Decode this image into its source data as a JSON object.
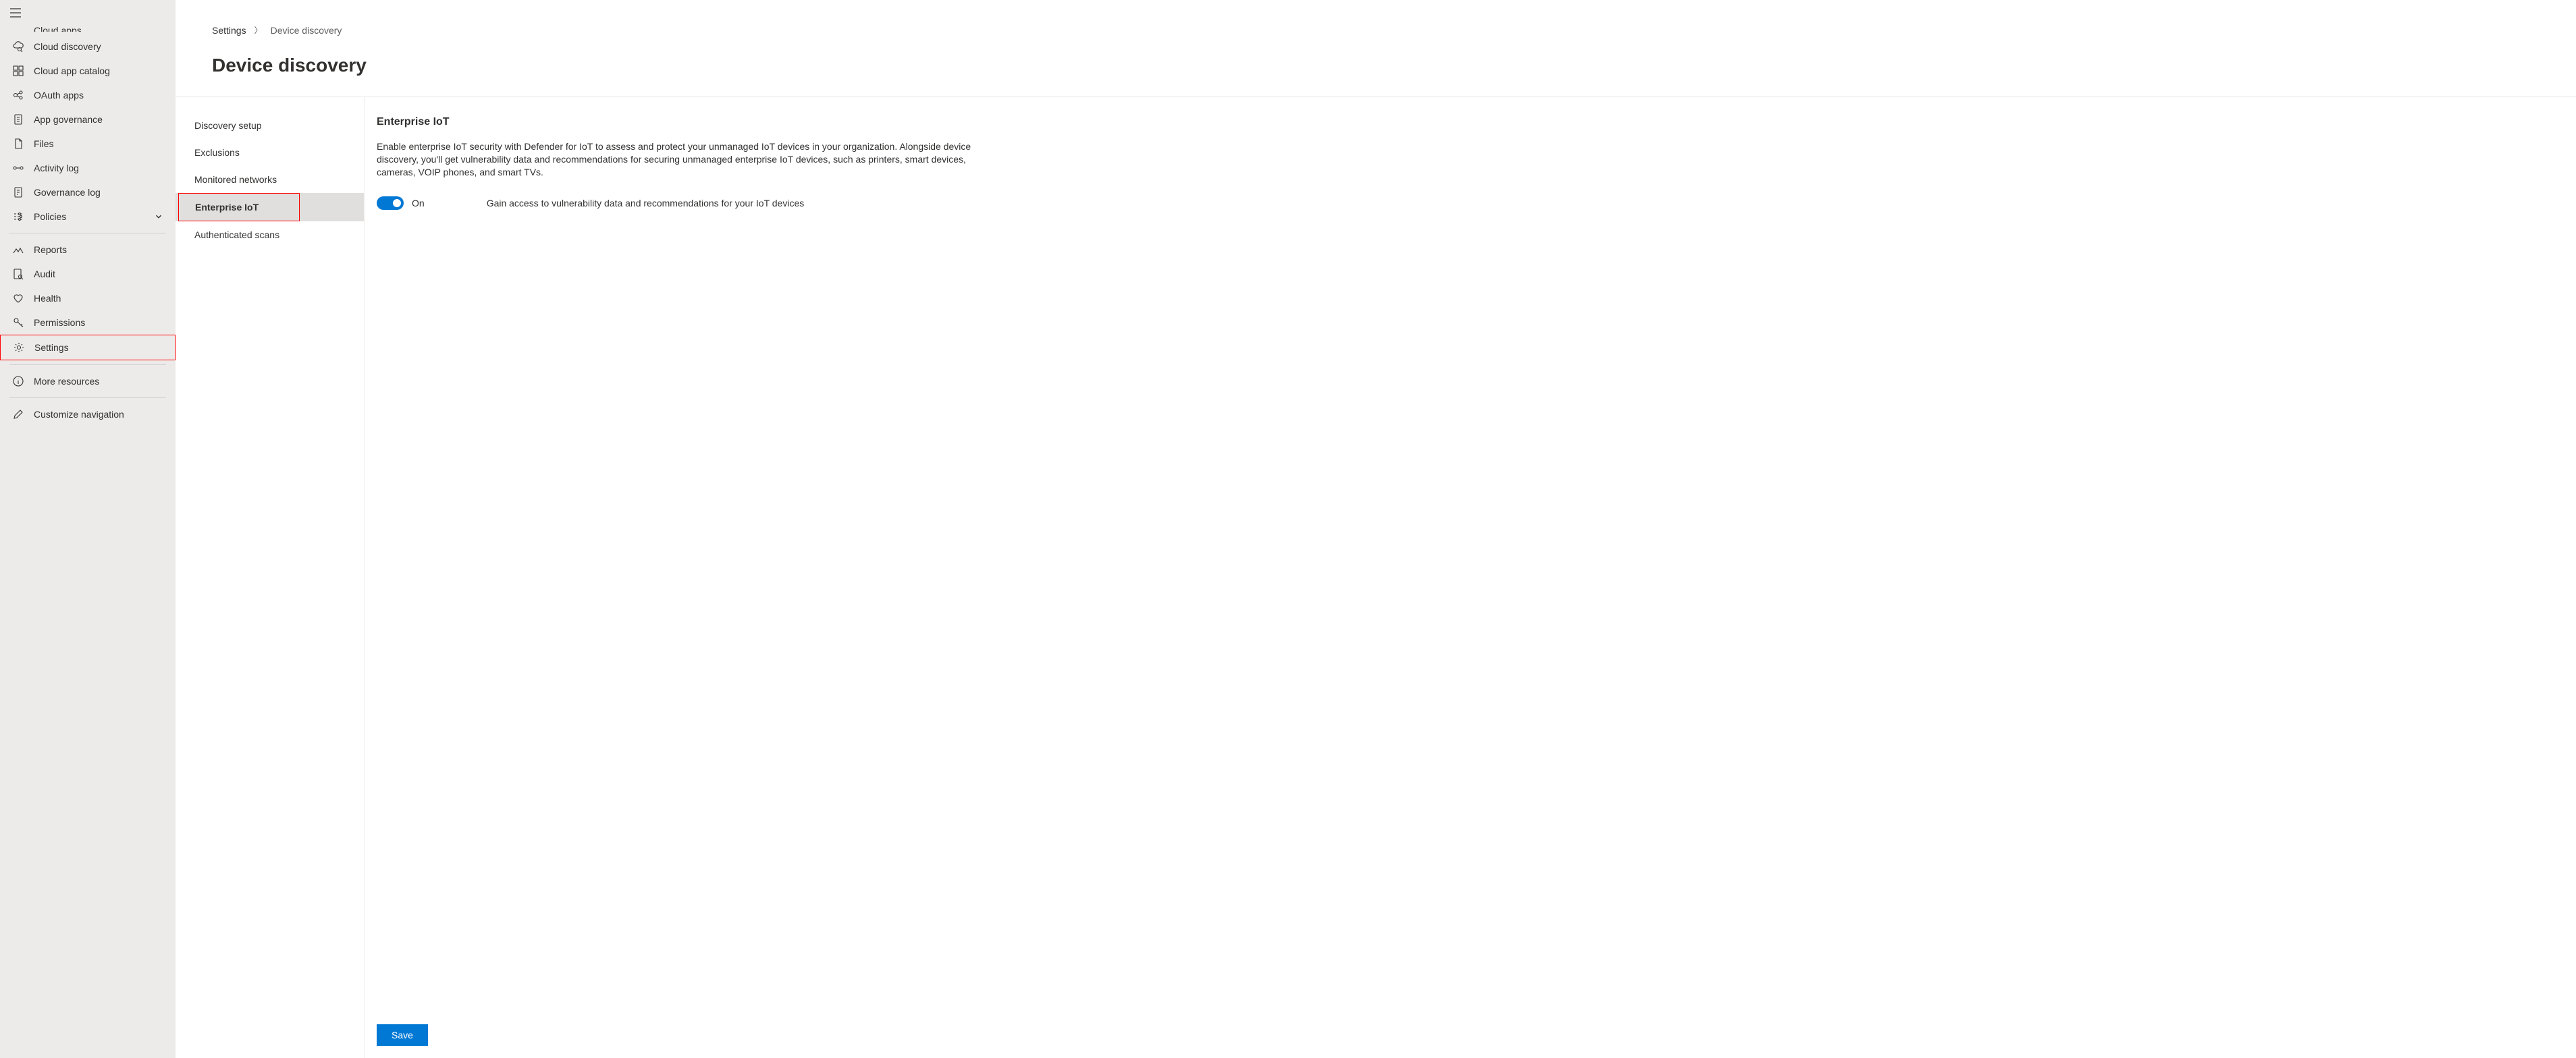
{
  "sidebar": {
    "truncated_top": "Cloud apps",
    "items": [
      {
        "icon": "cloud-discovery",
        "label": "Cloud discovery"
      },
      {
        "icon": "cloud-catalog",
        "label": "Cloud app catalog"
      },
      {
        "icon": "oauth",
        "label": "OAuth apps"
      },
      {
        "icon": "governance",
        "label": "App governance"
      },
      {
        "icon": "files",
        "label": "Files"
      },
      {
        "icon": "activity",
        "label": "Activity log"
      },
      {
        "icon": "governance-log",
        "label": "Governance log"
      },
      {
        "icon": "policies",
        "label": "Policies",
        "expandable": true
      }
    ],
    "section2": [
      {
        "icon": "reports",
        "label": "Reports"
      },
      {
        "icon": "audit",
        "label": "Audit"
      },
      {
        "icon": "health",
        "label": "Health"
      },
      {
        "icon": "permissions",
        "label": "Permissions"
      },
      {
        "icon": "settings",
        "label": "Settings",
        "highlighted": true
      }
    ],
    "section3": [
      {
        "icon": "more",
        "label": "More resources"
      }
    ],
    "section4": [
      {
        "icon": "customize",
        "label": "Customize navigation"
      }
    ]
  },
  "breadcrumb": {
    "parent": "Settings",
    "current": "Device discovery"
  },
  "page_title": "Device discovery",
  "subnav": [
    {
      "label": "Discovery setup"
    },
    {
      "label": "Exclusions"
    },
    {
      "label": "Monitored networks"
    },
    {
      "label": "Enterprise IoT",
      "active": true,
      "highlighted": true
    },
    {
      "label": "Authenticated scans"
    }
  ],
  "panel": {
    "title": "Enterprise IoT",
    "description": "Enable enterprise IoT security with Defender for IoT to assess and protect your unmanaged IoT devices in your organization. Alongside device discovery, you'll get vulnerability data and recommendations for securing unmanaged enterprise IoT devices, such as printers, smart devices, cameras, VOIP phones, and smart TVs.",
    "toggle_state": "On",
    "toggle_desc": "Gain access to vulnerability data and recommendations for your IoT devices",
    "save_label": "Save"
  }
}
